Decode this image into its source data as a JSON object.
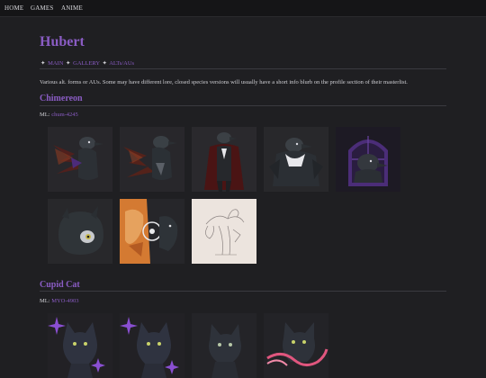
{
  "nav": {
    "items": [
      "HOME",
      "GAMES",
      "ANIME"
    ]
  },
  "page": {
    "title": "Hubert",
    "breadcrumb": [
      {
        "label": "MAIN"
      },
      {
        "label": "GALLERY"
      },
      {
        "label": "ALTs/AUs"
      }
    ],
    "breadcrumb_separator": "✦",
    "description": "Various alt. forms or AUs. Some may have different lore, closed species versions will usually have a short info blurb on the profile section of their masterlist."
  },
  "sections": [
    {
      "title": "Chimereon",
      "ml_label": "ML:",
      "ml_link": "chum-4245",
      "thumbnails": [
        {
          "icon": "crow-character-dark-red"
        },
        {
          "icon": "crow-character-dark-red-2"
        },
        {
          "icon": "crow-character-red-cloak"
        },
        {
          "icon": "crow-character-white-ruff"
        },
        {
          "icon": "crow-character-purple-window"
        },
        {
          "icon": "round-dark-creature"
        },
        {
          "icon": "orange-fox-and-dark-creature"
        },
        {
          "icon": "sketch-bird-creature"
        }
      ]
    },
    {
      "title": "Cupid Cat",
      "ml_label": "ML:",
      "ml_link": "MYO-4903",
      "thumbnails": [
        {
          "icon": "dark-cat-purple-sparkles"
        },
        {
          "icon": "dark-cat-purple-sparkles-2"
        },
        {
          "icon": "dark-cat-sitting"
        },
        {
          "icon": "dark-cat-pink-ribbon"
        }
      ]
    }
  ],
  "colors": {
    "background": "#1f1f22",
    "accent": "#8a5cc4",
    "text": "#cfcfd4"
  }
}
